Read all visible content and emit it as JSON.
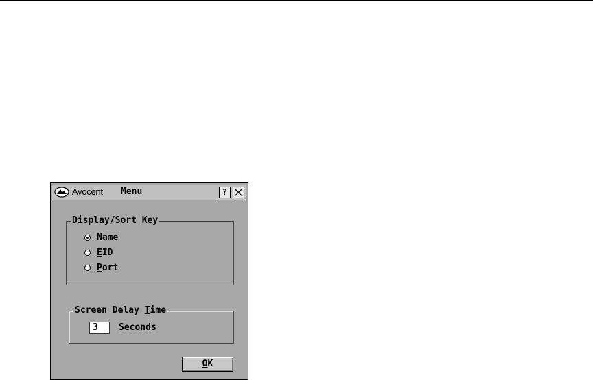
{
  "window": {
    "brand": "Avocent",
    "title": "Menu",
    "help_label": "?",
    "close_label": "X"
  },
  "sort_group": {
    "legend": "Display/Sort Key",
    "options": [
      {
        "first": "N",
        "rest": "ame",
        "selected": true
      },
      {
        "first": "E",
        "rest": "ID",
        "selected": false
      },
      {
        "first": "P",
        "rest": "ort",
        "selected": false
      }
    ]
  },
  "delay_group": {
    "legend_before": "Screen Delay ",
    "legend_ul": "T",
    "legend_after": "ime",
    "value": "3",
    "unit": "Seconds"
  },
  "buttons": {
    "ok_first": "O",
    "ok_rest": "K"
  }
}
